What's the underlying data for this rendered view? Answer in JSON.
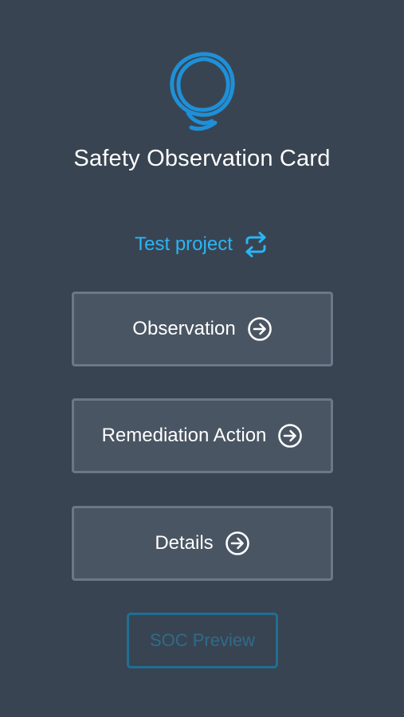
{
  "app": {
    "title": "Safety Observation Card",
    "logo_icon": "spiral-ring-logo",
    "accent_color": "#29b6f6"
  },
  "project": {
    "name": "Test project",
    "switch_icon": "swap-arrows-icon"
  },
  "menu": {
    "items": [
      {
        "label": "Observation",
        "icon": "arrow-circle-right-icon"
      },
      {
        "label": "Remediation Action",
        "icon": "arrow-circle-right-icon"
      },
      {
        "label": "Details",
        "icon": "arrow-circle-right-icon"
      }
    ]
  },
  "preview": {
    "label": "SOC Preview",
    "disabled": true
  }
}
